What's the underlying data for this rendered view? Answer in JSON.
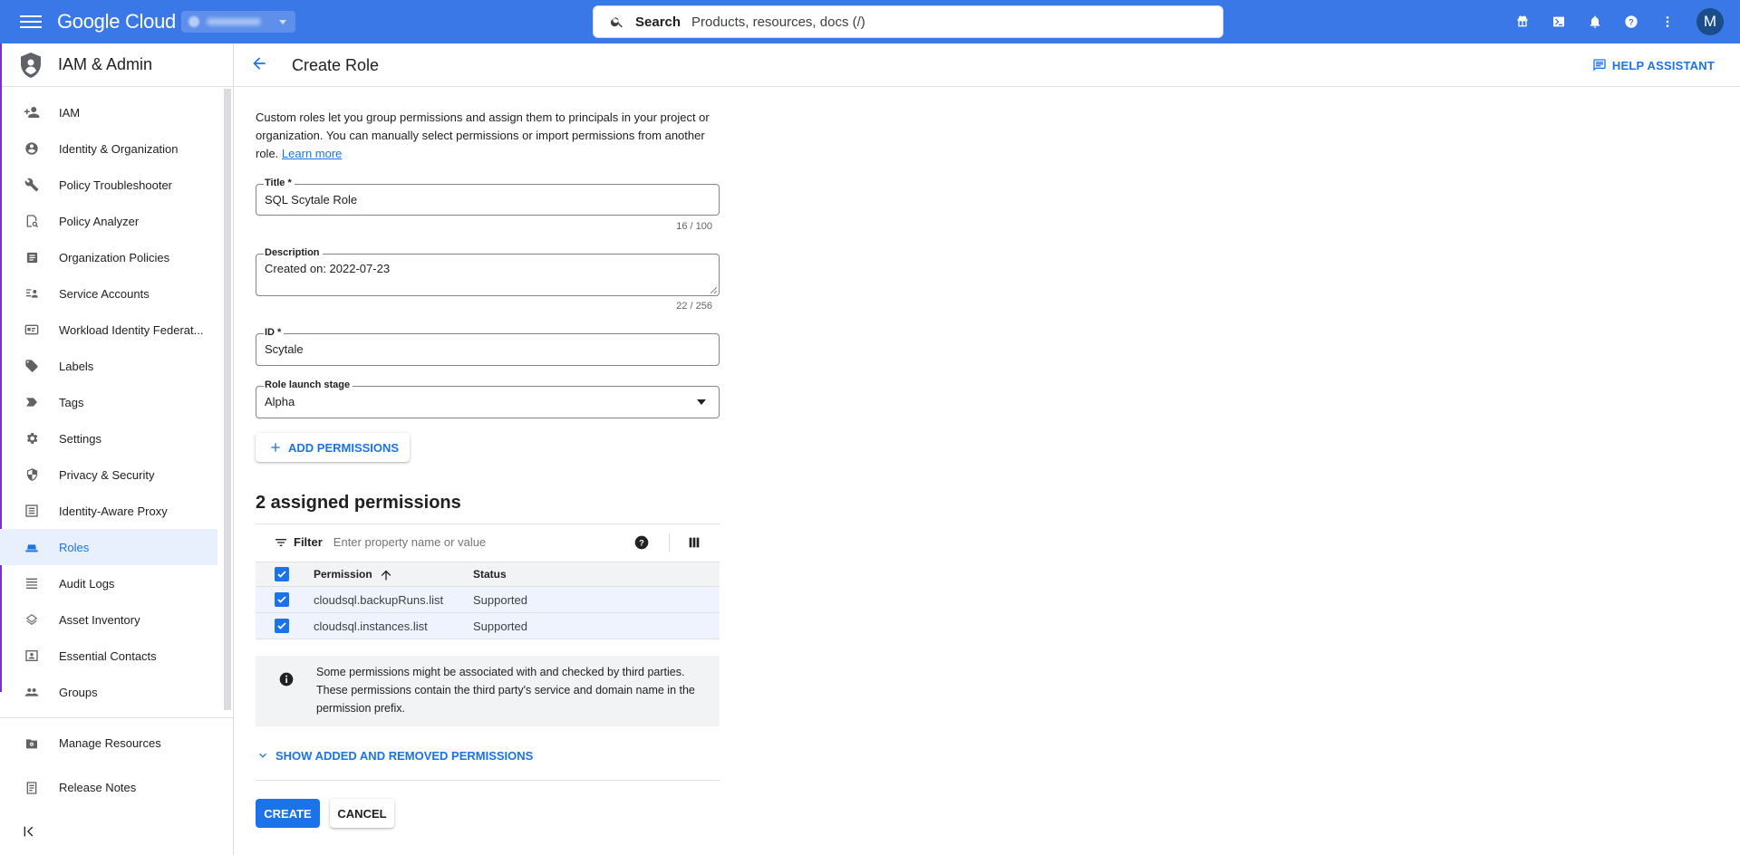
{
  "topbar": {
    "brand": "Google Cloud",
    "search_label": "Search",
    "search_placeholder": "Products, resources, docs (/)",
    "avatar_initial": "M"
  },
  "sidebar": {
    "title": "IAM & Admin",
    "items": [
      {
        "label": "IAM",
        "icon": "person-add-icon"
      },
      {
        "label": "Identity & Organization",
        "icon": "account-circle-icon"
      },
      {
        "label": "Policy Troubleshooter",
        "icon": "wrench-icon"
      },
      {
        "label": "Policy Analyzer",
        "icon": "policy-analyzer-icon"
      },
      {
        "label": "Organization Policies",
        "icon": "document-list-icon"
      },
      {
        "label": "Service Accounts",
        "icon": "service-account-icon"
      },
      {
        "label": "Workload Identity Federat...",
        "icon": "id-card-icon"
      },
      {
        "label": "Labels",
        "icon": "label-tag-icon"
      },
      {
        "label": "Tags",
        "icon": "tag-arrow-icon"
      },
      {
        "label": "Settings",
        "icon": "gear-icon"
      },
      {
        "label": "Privacy & Security",
        "icon": "shield-icon"
      },
      {
        "label": "Identity-Aware Proxy",
        "icon": "proxy-icon"
      },
      {
        "label": "Roles",
        "icon": "roles-hat-icon",
        "active": true
      },
      {
        "label": "Audit Logs",
        "icon": "list-lines-icon"
      },
      {
        "label": "Asset Inventory",
        "icon": "diamond-stack-icon"
      },
      {
        "label": "Essential Contacts",
        "icon": "contacts-icon"
      },
      {
        "label": "Groups",
        "icon": "group-icon"
      }
    ],
    "bottom": [
      {
        "label": "Manage Resources",
        "icon": "gear-folder-icon"
      },
      {
        "label": "Release Notes",
        "icon": "notes-icon"
      }
    ]
  },
  "header": {
    "title": "Create Role",
    "help_assistant": "HELP ASSISTANT"
  },
  "intro": {
    "text": "Custom roles let you group permissions and assign them to principals in your project or organization. You can manually select permissions or import permissions from another role.",
    "learn_more": "Learn more"
  },
  "form": {
    "title_label": "Title *",
    "title_value": "SQL Scytale Role",
    "title_counter": "16 / 100",
    "description_label": "Description",
    "description_value": "Created on: 2022-07-23",
    "description_counter": "22 / 256",
    "id_label": "ID *",
    "id_value": "Scytale",
    "stage_label": "Role launch stage",
    "stage_value": "Alpha",
    "add_permissions": "ADD PERMISSIONS"
  },
  "permissions": {
    "heading": "2 assigned permissions",
    "filter_label": "Filter",
    "filter_placeholder": "Enter property name or value",
    "columns": {
      "permission": "Permission",
      "status": "Status"
    },
    "rows": [
      {
        "permission": "cloudsql.backupRuns.list",
        "status": "Supported"
      },
      {
        "permission": "cloudsql.instances.list",
        "status": "Supported"
      }
    ],
    "info": "Some permissions might be associated with and checked by third parties. These permissions contain the third party's service and domain name in the permission prefix.",
    "show_toggle": "SHOW ADDED AND REMOVED PERMISSIONS"
  },
  "actions": {
    "create": "CREATE",
    "cancel": "CANCEL"
  },
  "colors": {
    "topbar": "#3b78e7",
    "accent": "#1a73e8",
    "nav_active_bg": "#e8f0fe"
  }
}
